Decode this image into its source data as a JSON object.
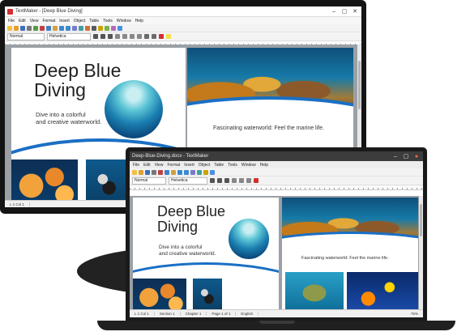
{
  "desktop": {
    "window_title": "TextMaker - [Deep Blue Diving]",
    "menu": [
      "File",
      "Edit",
      "View",
      "Format",
      "Insert",
      "Object",
      "Table",
      "Tools",
      "Window",
      "Help"
    ],
    "paragraph_style": "Normal",
    "font_name": "Helvetica",
    "headline_line1": "Deep Blue",
    "headline_line2": "Diving",
    "tagline_line1": "Dive into a colorful",
    "tagline_line2": "and creative waterworld.",
    "caption": "Fascinating waterworld: Feel the marine life.",
    "status_position": "L 1 Col 1"
  },
  "laptop": {
    "window_title": "Deep-Blue-Diving.docx - TextMaker",
    "menu": [
      "File",
      "Edit",
      "View",
      "Format",
      "Insert",
      "Object",
      "Table",
      "Tools",
      "Window",
      "Help"
    ],
    "paragraph_style": "Normal",
    "font_name": "Helvetica",
    "headline_line1": "Deep Blue",
    "headline_line2": "Diving",
    "tagline_line1": "Dive into a colorful",
    "tagline_line2": "and creative waterworld.",
    "caption": "Fascinating waterworld: Feel the marine life.",
    "status": {
      "position": "L 1 Col 1",
      "section": "Section 1",
      "chapter": "Chapter 1",
      "page": "Page 1 of 1",
      "language": "English",
      "zoom": "75%"
    }
  },
  "colors": {
    "ocean_blue": "#1a6fc4",
    "accent_red": "#d32f2f"
  }
}
